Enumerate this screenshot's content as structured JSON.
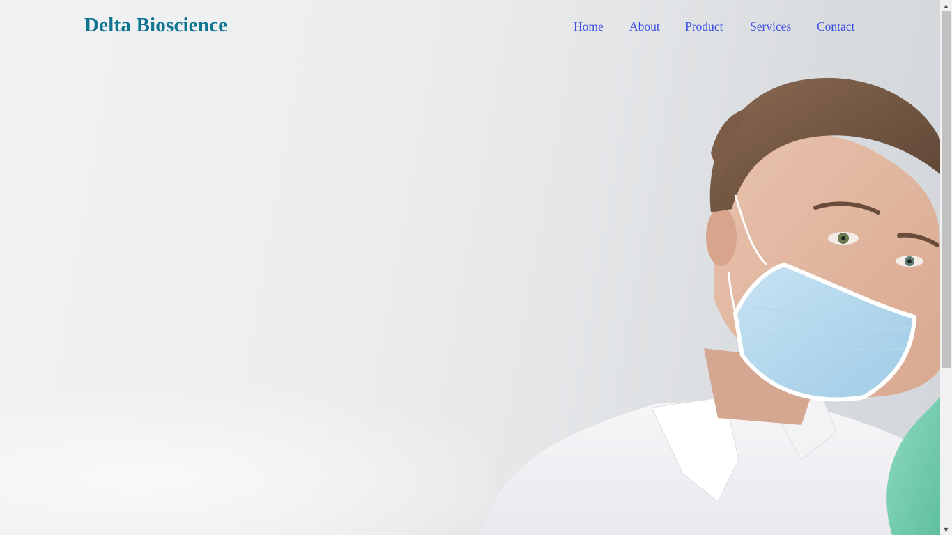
{
  "brand": {
    "name": "Delta Bioscience",
    "color": "#0e7490"
  },
  "nav": {
    "link_color": "#3b4fe0",
    "items": [
      {
        "label": "Home"
      },
      {
        "label": "About"
      },
      {
        "label": "Product"
      },
      {
        "label": "Services"
      },
      {
        "label": "Contact"
      }
    ]
  },
  "hero": {
    "image_subject": "lab-technician-photo",
    "background": "#eceeef"
  },
  "scrollbar": {
    "up_icon": "▲",
    "down_icon": "▼"
  }
}
